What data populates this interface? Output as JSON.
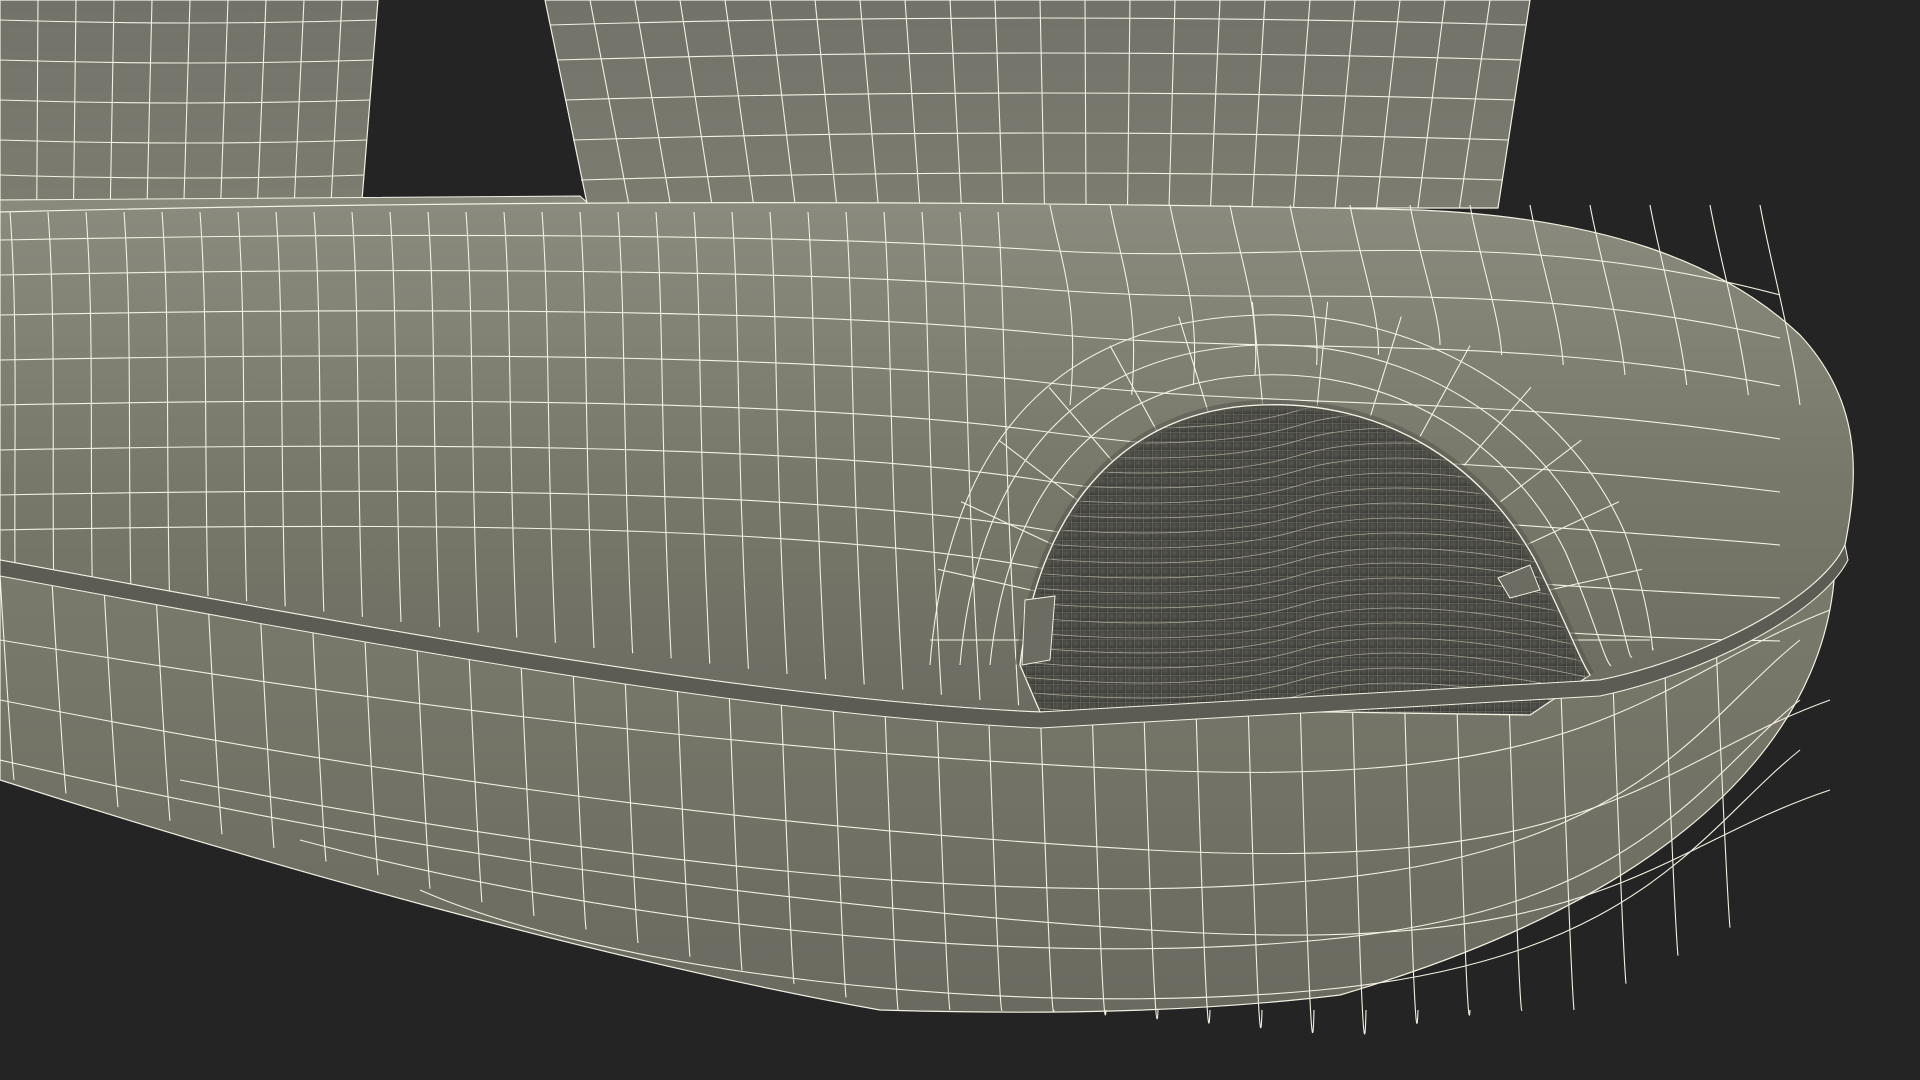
{
  "viewport": {
    "background_color": "#242424"
  },
  "model": {
    "surface_color": "#78786a",
    "surface_dark_color": "#62625a",
    "surface_light_color": "#86867a",
    "wire_color": "#f2f0e2",
    "cavity_color": "#4e4e48"
  }
}
